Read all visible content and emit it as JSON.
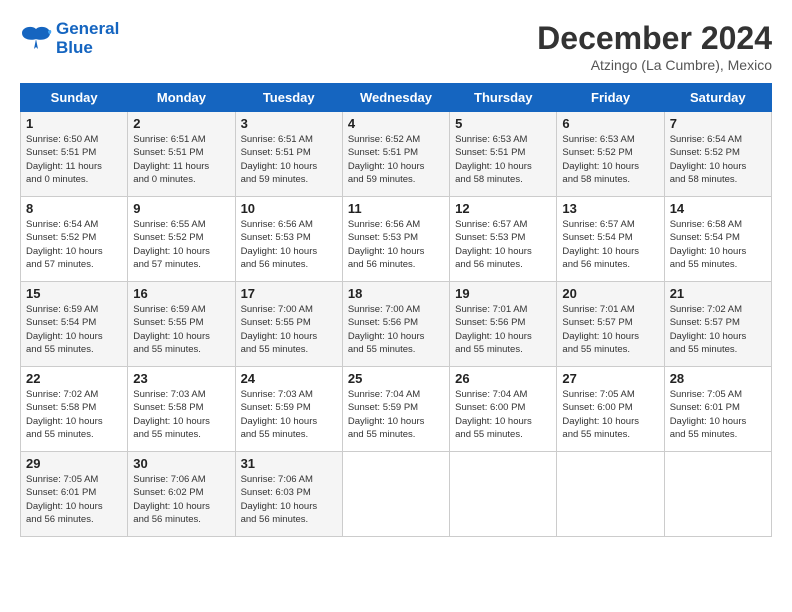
{
  "logo": {
    "line1": "General",
    "line2": "Blue"
  },
  "title": "December 2024",
  "location": "Atzingo (La Cumbre), Mexico",
  "days_header": [
    "Sunday",
    "Monday",
    "Tuesday",
    "Wednesday",
    "Thursday",
    "Friday",
    "Saturday"
  ],
  "weeks": [
    [
      {
        "day": "1",
        "info": "Sunrise: 6:50 AM\nSunset: 5:51 PM\nDaylight: 11 hours\nand 0 minutes."
      },
      {
        "day": "2",
        "info": "Sunrise: 6:51 AM\nSunset: 5:51 PM\nDaylight: 11 hours\nand 0 minutes."
      },
      {
        "day": "3",
        "info": "Sunrise: 6:51 AM\nSunset: 5:51 PM\nDaylight: 10 hours\nand 59 minutes."
      },
      {
        "day": "4",
        "info": "Sunrise: 6:52 AM\nSunset: 5:51 PM\nDaylight: 10 hours\nand 59 minutes."
      },
      {
        "day": "5",
        "info": "Sunrise: 6:53 AM\nSunset: 5:51 PM\nDaylight: 10 hours\nand 58 minutes."
      },
      {
        "day": "6",
        "info": "Sunrise: 6:53 AM\nSunset: 5:52 PM\nDaylight: 10 hours\nand 58 minutes."
      },
      {
        "day": "7",
        "info": "Sunrise: 6:54 AM\nSunset: 5:52 PM\nDaylight: 10 hours\nand 58 minutes."
      }
    ],
    [
      {
        "day": "8",
        "info": "Sunrise: 6:54 AM\nSunset: 5:52 PM\nDaylight: 10 hours\nand 57 minutes."
      },
      {
        "day": "9",
        "info": "Sunrise: 6:55 AM\nSunset: 5:52 PM\nDaylight: 10 hours\nand 57 minutes."
      },
      {
        "day": "10",
        "info": "Sunrise: 6:56 AM\nSunset: 5:53 PM\nDaylight: 10 hours\nand 56 minutes."
      },
      {
        "day": "11",
        "info": "Sunrise: 6:56 AM\nSunset: 5:53 PM\nDaylight: 10 hours\nand 56 minutes."
      },
      {
        "day": "12",
        "info": "Sunrise: 6:57 AM\nSunset: 5:53 PM\nDaylight: 10 hours\nand 56 minutes."
      },
      {
        "day": "13",
        "info": "Sunrise: 6:57 AM\nSunset: 5:54 PM\nDaylight: 10 hours\nand 56 minutes."
      },
      {
        "day": "14",
        "info": "Sunrise: 6:58 AM\nSunset: 5:54 PM\nDaylight: 10 hours\nand 55 minutes."
      }
    ],
    [
      {
        "day": "15",
        "info": "Sunrise: 6:59 AM\nSunset: 5:54 PM\nDaylight: 10 hours\nand 55 minutes."
      },
      {
        "day": "16",
        "info": "Sunrise: 6:59 AM\nSunset: 5:55 PM\nDaylight: 10 hours\nand 55 minutes."
      },
      {
        "day": "17",
        "info": "Sunrise: 7:00 AM\nSunset: 5:55 PM\nDaylight: 10 hours\nand 55 minutes."
      },
      {
        "day": "18",
        "info": "Sunrise: 7:00 AM\nSunset: 5:56 PM\nDaylight: 10 hours\nand 55 minutes."
      },
      {
        "day": "19",
        "info": "Sunrise: 7:01 AM\nSunset: 5:56 PM\nDaylight: 10 hours\nand 55 minutes."
      },
      {
        "day": "20",
        "info": "Sunrise: 7:01 AM\nSunset: 5:57 PM\nDaylight: 10 hours\nand 55 minutes."
      },
      {
        "day": "21",
        "info": "Sunrise: 7:02 AM\nSunset: 5:57 PM\nDaylight: 10 hours\nand 55 minutes."
      }
    ],
    [
      {
        "day": "22",
        "info": "Sunrise: 7:02 AM\nSunset: 5:58 PM\nDaylight: 10 hours\nand 55 minutes."
      },
      {
        "day": "23",
        "info": "Sunrise: 7:03 AM\nSunset: 5:58 PM\nDaylight: 10 hours\nand 55 minutes."
      },
      {
        "day": "24",
        "info": "Sunrise: 7:03 AM\nSunset: 5:59 PM\nDaylight: 10 hours\nand 55 minutes."
      },
      {
        "day": "25",
        "info": "Sunrise: 7:04 AM\nSunset: 5:59 PM\nDaylight: 10 hours\nand 55 minutes."
      },
      {
        "day": "26",
        "info": "Sunrise: 7:04 AM\nSunset: 6:00 PM\nDaylight: 10 hours\nand 55 minutes."
      },
      {
        "day": "27",
        "info": "Sunrise: 7:05 AM\nSunset: 6:00 PM\nDaylight: 10 hours\nand 55 minutes."
      },
      {
        "day": "28",
        "info": "Sunrise: 7:05 AM\nSunset: 6:01 PM\nDaylight: 10 hours\nand 55 minutes."
      }
    ],
    [
      {
        "day": "29",
        "info": "Sunrise: 7:05 AM\nSunset: 6:01 PM\nDaylight: 10 hours\nand 56 minutes."
      },
      {
        "day": "30",
        "info": "Sunrise: 7:06 AM\nSunset: 6:02 PM\nDaylight: 10 hours\nand 56 minutes."
      },
      {
        "day": "31",
        "info": "Sunrise: 7:06 AM\nSunset: 6:03 PM\nDaylight: 10 hours\nand 56 minutes."
      },
      {
        "day": "",
        "info": ""
      },
      {
        "day": "",
        "info": ""
      },
      {
        "day": "",
        "info": ""
      },
      {
        "day": "",
        "info": ""
      }
    ]
  ]
}
